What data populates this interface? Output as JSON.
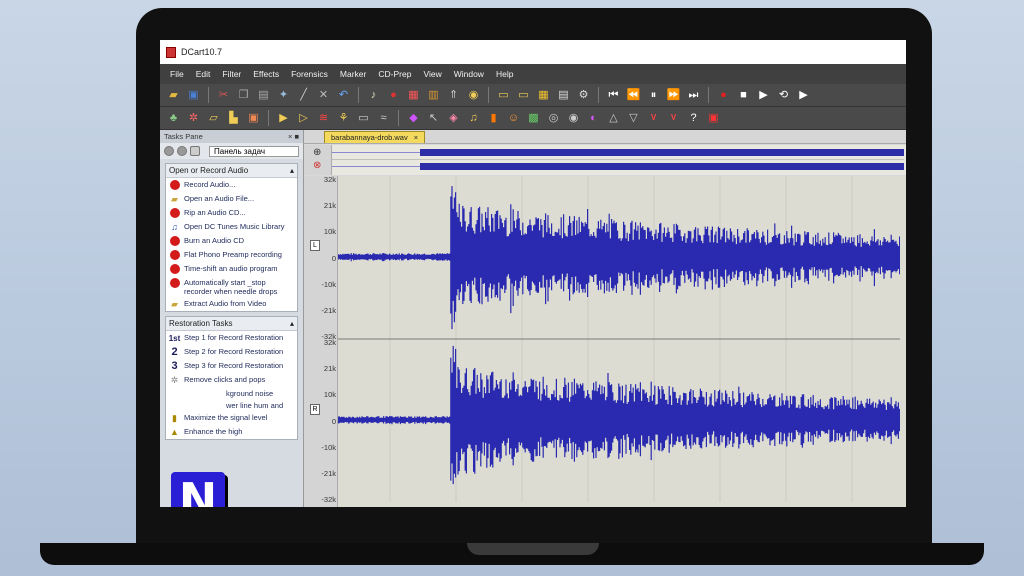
{
  "window": {
    "title": "DCart10.7"
  },
  "menu": [
    "File",
    "Edit",
    "Filter",
    "Effects",
    "Forensics",
    "Marker",
    "CD-Prep",
    "View",
    "Window",
    "Help"
  ],
  "tasks_pane": {
    "header": "Tasks Pane",
    "dropdown": "Панель задач",
    "groups": [
      {
        "title": "Open or Record Audio",
        "items": [
          {
            "icon": "record-icon",
            "label": "Record Audio..."
          },
          {
            "icon": "folder-open-icon",
            "label": "Open an Audio File..."
          },
          {
            "icon": "record-icon",
            "label": "Rip an Audio CD..."
          },
          {
            "icon": "music-library-icon",
            "label": "Open DC Tunes Music Library"
          },
          {
            "icon": "cd-burn-icon",
            "label": "Burn an Audio CD"
          },
          {
            "icon": "record-icon",
            "label": "Flat Phono Preamp recording"
          },
          {
            "icon": "record-icon",
            "label": "Time-shift an audio program"
          },
          {
            "icon": "record-icon",
            "label": "Automatically start _stop recorder when needle drops"
          },
          {
            "icon": "folder-open-icon",
            "label": "Extract Audio from Video"
          }
        ]
      },
      {
        "title": "Restoration Tasks",
        "items": [
          {
            "icon": "step-1-icon",
            "num": "1st",
            "label": "Step 1 for Record Restoration"
          },
          {
            "icon": "step-2-icon",
            "num": "2",
            "label": "Step 2 for Record Restoration"
          },
          {
            "icon": "step-3-icon",
            "num": "3",
            "label": "Step 3 for Record Restoration"
          },
          {
            "icon": "declick-icon",
            "label": "Remove clicks and pops"
          },
          {
            "icon": "noise-icon",
            "label": "kground noise"
          },
          {
            "icon": "hum-icon",
            "label": "wer line hum and"
          },
          {
            "icon": "level-icon",
            "label": "Maximize the signal level"
          },
          {
            "icon": "enhance-icon",
            "label": "Enhance the high"
          }
        ]
      }
    ]
  },
  "editor": {
    "file_tab": "barabannaya-drob.wav",
    "tab_close": "×",
    "channel_left": "L",
    "channel_right": "R",
    "ticks": [
      "32k",
      "21k",
      "10k",
      "0",
      "-10k",
      "-21k",
      "-32k"
    ]
  },
  "watermark_letter": "N"
}
